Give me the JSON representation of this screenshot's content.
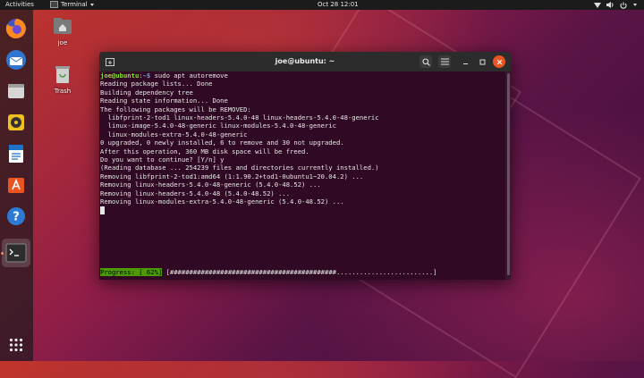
{
  "topbar": {
    "activities": "Activities",
    "app": "Terminal",
    "datetime": "Oct 28  12:01"
  },
  "desktop": {
    "home_label": "joe",
    "trash_label": "Trash"
  },
  "dock": {
    "items": [
      "firefox-icon",
      "thunderbird-icon",
      "files-icon",
      "rhythmbox-icon",
      "writer-icon",
      "software-icon",
      "help-icon",
      "terminal-icon"
    ]
  },
  "terminal": {
    "title": "joe@ubuntu: ~",
    "prompt_user": "joe@ubuntu",
    "prompt_path": ":~$",
    "command": " sudo apt autoremove",
    "lines": [
      "Reading package lists... Done",
      "Building dependency tree",
      "Reading state information... Done",
      "The following packages will be REMOVED:",
      "  libfprint-2-tod1 linux-headers-5.4.0-48 linux-headers-5.4.0-48-generic",
      "  linux-image-5.4.0-48-generic linux-modules-5.4.0-48-generic",
      "  linux-modules-extra-5.4.0-48-generic",
      "0 upgraded, 0 newly installed, 6 to remove and 30 not upgraded.",
      "After this operation, 360 MB disk space will be freed.",
      "Do you want to continue? [Y/n] y",
      "(Reading database ... 254239 files and directories currently installed.)",
      "Removing libfprint-2-tod1:amd64 (1:1.90.2+tod1-0ubuntu1~20.04.2) ...",
      "Removing linux-headers-5.4.0-48-generic (5.4.0-48.52) ...",
      "Removing linux-headers-5.4.0-48 (5.4.0-48.52) ...",
      "Removing linux-modules-extra-5.4.0-48-generic (5.4.0-48.52) ..."
    ],
    "progress_label": "Progress: [ 62%]",
    "progress_bar": " [###########################################.........................]",
    "progress_percent": 62
  },
  "colors": {
    "terminal_bg": "#300a24",
    "prompt_green": "#8ae234",
    "path_blue": "#729fcf",
    "progress_green": "#4e9a06",
    "accent_orange": "#e95420"
  }
}
